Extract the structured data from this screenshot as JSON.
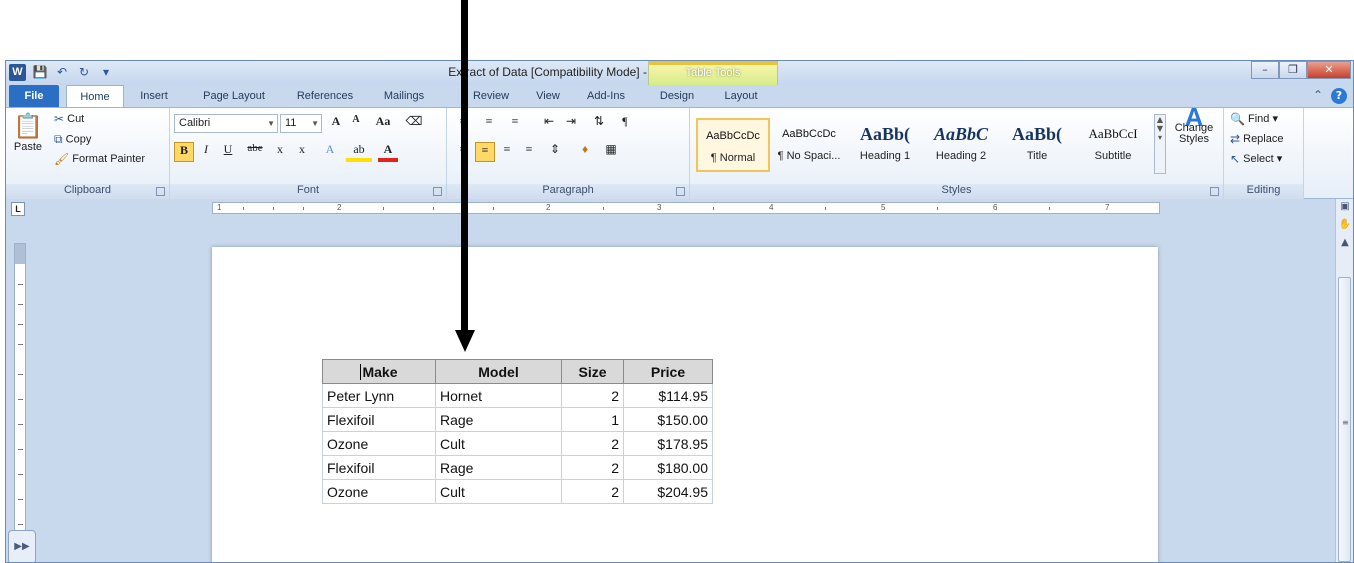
{
  "window": {
    "title": "Extract of Data [Compatibility Mode] - Microsoft Word",
    "context_tab": "Table Tools",
    "app_icon": "W"
  },
  "tabs": [
    "File",
    "Home",
    "Insert",
    "Page Layout",
    "References",
    "Mailings",
    "Review",
    "View",
    "Add-Ins",
    "Design",
    "Layout"
  ],
  "clipboard": {
    "paste": "Paste",
    "cut": "Cut",
    "copy": "Copy",
    "format_painter": "Format Painter",
    "label": "Clipboard"
  },
  "font": {
    "name": "Calibri",
    "size": "11",
    "label": "Font",
    "grow": "A",
    "shrink": "A",
    "case": "Aa",
    "bold": "B",
    "italic": "I",
    "underline": "U",
    "strike": "abe",
    "subscript": "x",
    "superscript": "x",
    "highlight": "ab",
    "color": "A"
  },
  "paragraph": {
    "label": "Paragraph"
  },
  "styles": {
    "label": "Styles",
    "items": [
      {
        "sample": "AaBbCcDc",
        "name": "¶ Normal"
      },
      {
        "sample": "AaBbCcDc",
        "name": "¶ No Spaci..."
      },
      {
        "sample": "AaBb(",
        "name": "Heading 1"
      },
      {
        "sample": "AaBbC",
        "name": "Heading 2"
      },
      {
        "sample": "AaBb(",
        "name": "Title"
      },
      {
        "sample": "AaBbCcI",
        "name": "Subtitle"
      }
    ],
    "change_styles": "Change Styles"
  },
  "editing": {
    "label": "Editing",
    "find": "Find",
    "replace": "Replace",
    "select": "Select"
  },
  "ruler": {
    "numbers": [
      "1",
      "2",
      "3",
      "4",
      "5",
      "6",
      "7"
    ],
    "tab_selector": "L"
  },
  "table": {
    "headers": [
      "Make",
      "Model",
      "Size",
      "Price"
    ],
    "rows": [
      [
        "Peter Lynn",
        "Hornet",
        "2",
        "$114.95"
      ],
      [
        "Flexifoil",
        "Rage",
        "1",
        "$150.00"
      ],
      [
        "Ozone",
        "Cult",
        "2",
        "$178.95"
      ],
      [
        "Flexifoil",
        "Rage",
        "2",
        "$180.00"
      ],
      [
        "Ozone",
        "Cult",
        "2",
        "$204.95"
      ]
    ]
  }
}
